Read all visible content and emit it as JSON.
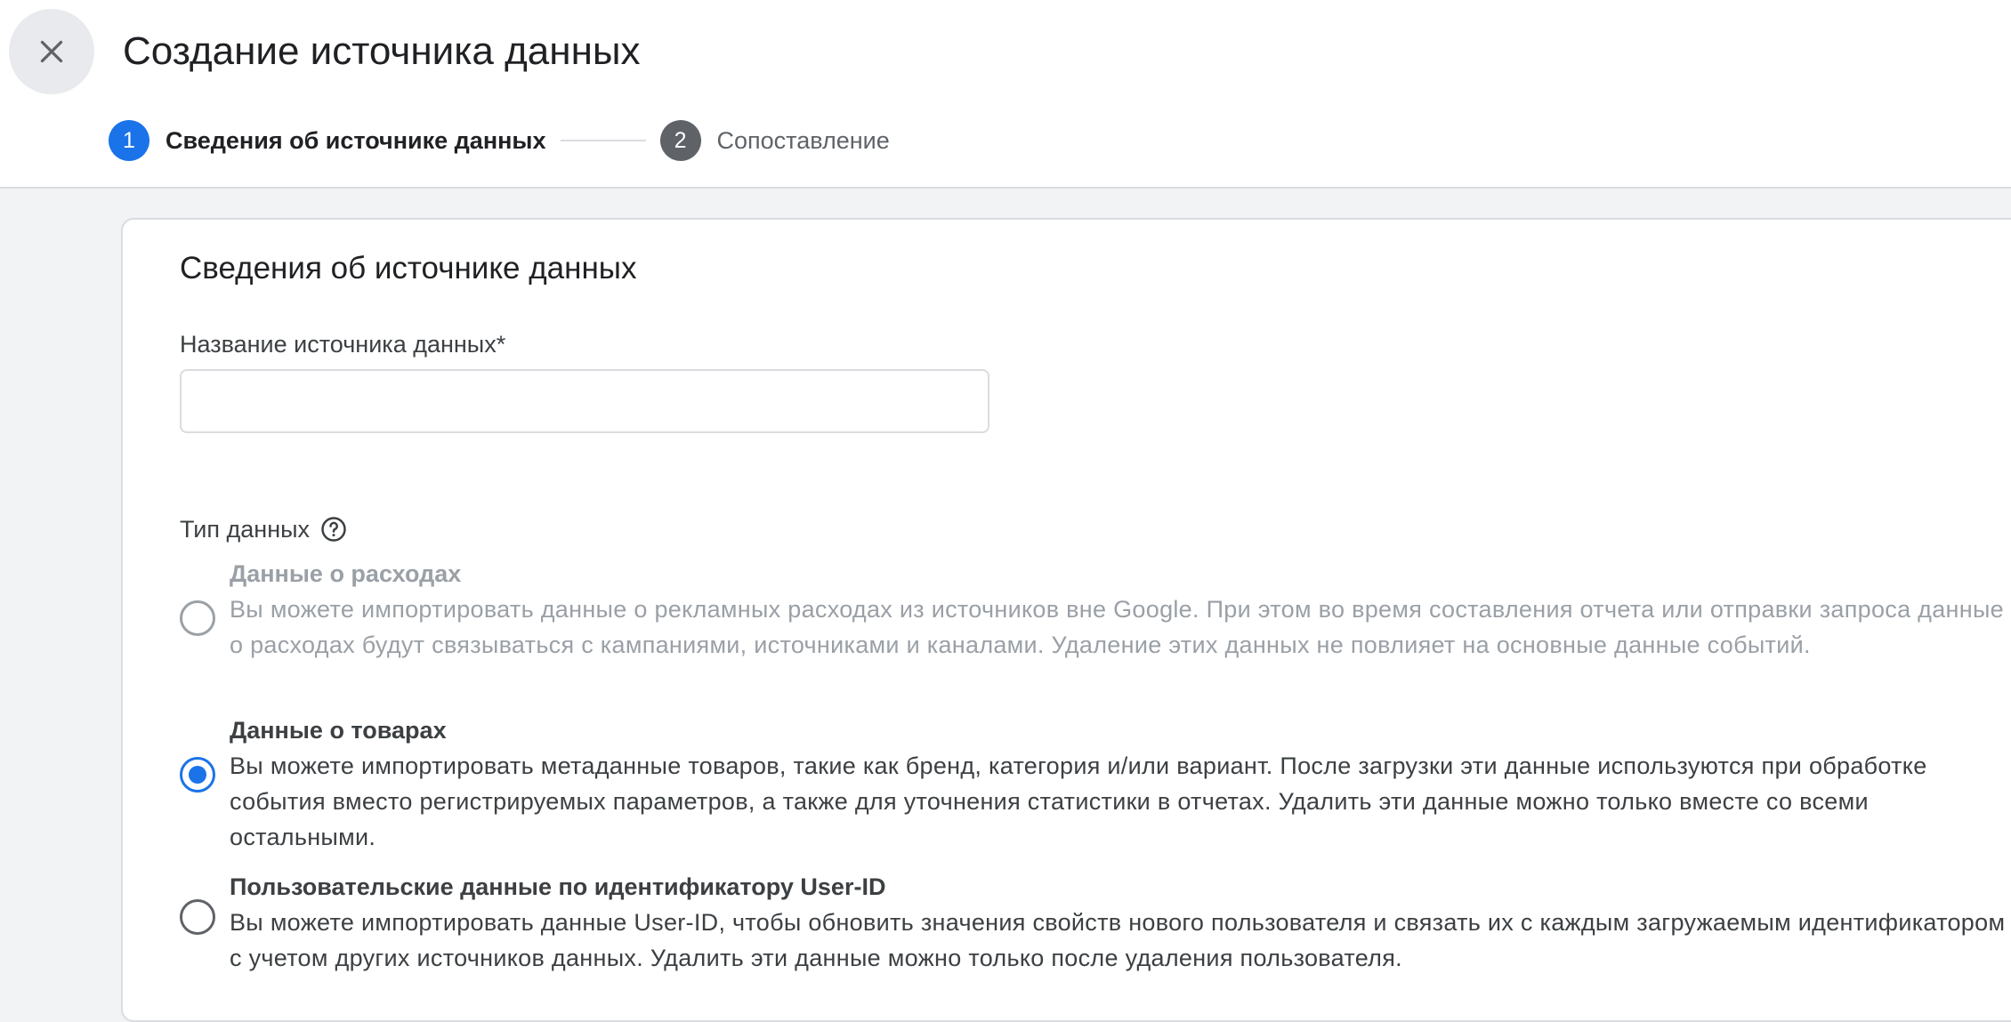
{
  "header": {
    "close_icon": "close-icon",
    "title": "Создание источника данных"
  },
  "stepper": {
    "steps": [
      {
        "number": "1",
        "label": "Сведения об источнике данных",
        "state": "active",
        "color": "#1a73e8"
      },
      {
        "number": "2",
        "label": "Сопоставление",
        "state": "inactive",
        "color": "#5f6368"
      }
    ]
  },
  "card": {
    "title": "Сведения об источнике данных",
    "name_field": {
      "label": "Название источника данных*",
      "value": "",
      "placeholder": ""
    },
    "data_type": {
      "label": "Тип данных",
      "help_icon": "help-circle-icon",
      "options": [
        {
          "title": "Данные о расходах",
          "description": "Вы можете импортировать данные о рекламных расходах из источников вне Google. При этом во время составления отчета или отправки запроса данные о расходах будут связываться с кампаниями, источниками и каналами. Удаление этих данных не повлияет на основные данные событий.",
          "selected": false,
          "disabled": true
        },
        {
          "title": "Данные о товарах",
          "description": "Вы можете импортировать метаданные товаров, такие как бренд, категория и/или вариант. После загрузки эти данные используются при обработке события вместо регистрируемых параметров, а также для уточнения статистики в отчетах. Удалить эти данные можно только вместе со всеми остальными.",
          "selected": true,
          "disabled": false
        },
        {
          "title": "Пользовательские данные по идентификатору User-ID",
          "description": "Вы можете импортировать данные User-ID, чтобы обновить значения свойств нового пользователя и связать их с каждым загружаемым идентификатором с учетом других источников данных. Удалить эти данные можно только после удаления пользователя.",
          "selected": false,
          "disabled": false
        }
      ]
    }
  },
  "colors": {
    "accent": "#1a73e8",
    "background": "#f1f3f4",
    "disabled_text": "#9aa0a6"
  }
}
